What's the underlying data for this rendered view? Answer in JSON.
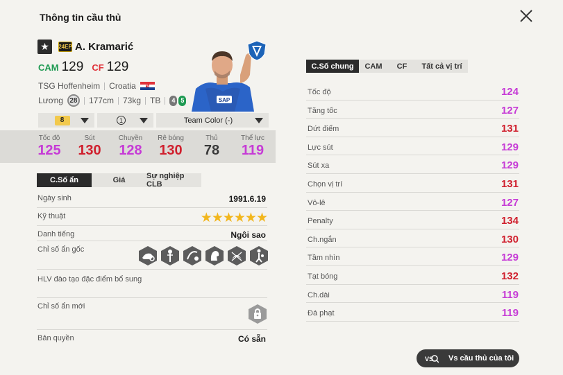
{
  "header": {
    "title": "Thông tin cầu thủ"
  },
  "colors": {
    "green": "#1e9a52",
    "red": "#e0323a",
    "purple": "#c63bd6",
    "crimson": "#d0202e",
    "dark": "#1a1a1a"
  },
  "player": {
    "season_badge": "24EP",
    "name": "A. Kramarić",
    "positions": [
      {
        "pos": "CAM",
        "rating": "129"
      },
      {
        "pos": "CF",
        "rating": "129"
      }
    ],
    "club": "TSG Hoffenheim",
    "nation": "Croatia",
    "salary_label": "Lương",
    "salary": "28",
    "height": "177cm",
    "weight": "73kg",
    "body_type": "TB",
    "weak_foot_left": "4",
    "weak_foot_right": "5",
    "jersey_text": "SAP"
  },
  "selectors": {
    "level": "8",
    "slot": "1",
    "team_color": "Team Color (-)"
  },
  "summary_stats": [
    {
      "label": "Tốc độ",
      "value": "125",
      "color": "#c63bd6"
    },
    {
      "label": "Sút",
      "value": "130",
      "color": "#d0202e"
    },
    {
      "label": "Chuyền",
      "value": "128",
      "color": "#c63bd6"
    },
    {
      "label": "Rê bóng",
      "value": "130",
      "color": "#d0202e"
    },
    {
      "label": "Thủ",
      "value": "78",
      "color": "#3a3a3a"
    },
    {
      "label": "Thể lực",
      "value": "119",
      "color": "#c63bd6"
    }
  ],
  "left_tabs": [
    "C.Số ẩn",
    "Giá",
    "Sự nghiệp CLB"
  ],
  "left_rows": {
    "birth_label": "Ngày sinh",
    "birth": "1991.6.19",
    "skill_label": "Kỹ thuật",
    "skill_stars": "★★★★★★",
    "rep_label": "Danh tiếng",
    "rep": "Ngôi sao",
    "traits_label": "Chỉ số ẩn gốc",
    "coach_label": "HLV đào tạo đặc điểm bổ sung",
    "new_traits_label": "Chỉ số ẩn mới",
    "rights_label": "Bản quyền",
    "rights": "Có sẵn"
  },
  "trait_icons": [
    "long-shot-taker-icon",
    "power-header-icon",
    "finesse-shot-icon",
    "playmaker-icon",
    "flair-icon",
    "chip-shot-icon"
  ],
  "right_tabs": [
    "C.Số chung",
    "CAM",
    "CF",
    "Tất cả vị trí"
  ],
  "attributes": [
    {
      "label": "Tốc độ",
      "value": "124",
      "color": "#c63bd6"
    },
    {
      "label": "Tăng tốc",
      "value": "127",
      "color": "#c63bd6"
    },
    {
      "label": "Dứt điểm",
      "value": "131",
      "color": "#d0202e"
    },
    {
      "label": "Lực sút",
      "value": "129",
      "color": "#c63bd6"
    },
    {
      "label": "Sút xa",
      "value": "129",
      "color": "#c63bd6"
    },
    {
      "label": "Chọn vị trí",
      "value": "131",
      "color": "#d0202e"
    },
    {
      "label": "Vô-lê",
      "value": "127",
      "color": "#c63bd6"
    },
    {
      "label": "Penalty",
      "value": "134",
      "color": "#d0202e"
    },
    {
      "label": "Ch.ngắn",
      "value": "130",
      "color": "#d0202e"
    },
    {
      "label": "Tầm nhìn",
      "value": "129",
      "color": "#c63bd6"
    },
    {
      "label": "Tạt bóng",
      "value": "132",
      "color": "#d0202e"
    },
    {
      "label": "Ch.dài",
      "value": "119",
      "color": "#c63bd6"
    },
    {
      "label": "Đá phạt",
      "value": "119",
      "color": "#c63bd6"
    }
  ],
  "compare_button": "Vs cầu thủ của tôi"
}
